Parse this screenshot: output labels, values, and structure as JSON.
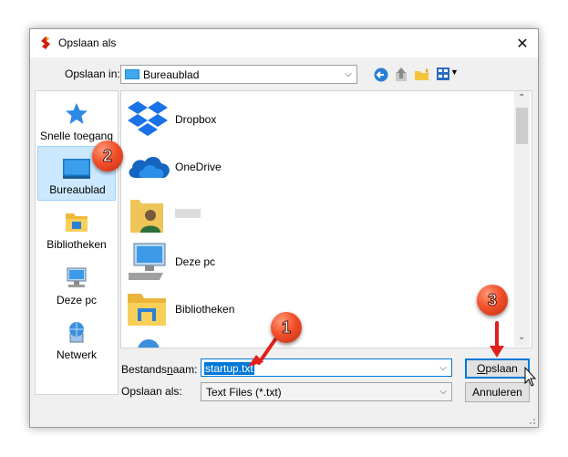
{
  "window": {
    "title": "Opslaan als"
  },
  "toolbar": {
    "save_in_label": "Opslaan in:",
    "location": "Bureaublad"
  },
  "sidebar": {
    "items": [
      {
        "label": "Snelle toegang",
        "icon": "star-icon"
      },
      {
        "label": "Bureaublad",
        "icon": "desktop-icon",
        "selected": true
      },
      {
        "label": "Bibliotheken",
        "icon": "library-folder-icon"
      },
      {
        "label": "Deze pc",
        "icon": "computer-icon"
      },
      {
        "label": "Netwerk",
        "icon": "network-icon"
      }
    ]
  },
  "files": [
    {
      "name": "Dropbox",
      "icon": "dropbox-icon"
    },
    {
      "name": "OneDrive",
      "icon": "onedrive-icon"
    },
    {
      "name": "",
      "icon": "user-folder-icon"
    },
    {
      "name": "Deze pc",
      "icon": "computer-icon"
    },
    {
      "name": "Bibliotheken",
      "icon": "library-folder-icon"
    }
  ],
  "form": {
    "filename_label_pre": "Bestands",
    "filename_label_u": "n",
    "filename_label_post": "aam:",
    "filename_value": "startup.txt",
    "filetype_label": "Opslaan als:",
    "filetype_value": "Text Files (*.txt)"
  },
  "buttons": {
    "save_u": "O",
    "save_rest": "pslaan",
    "cancel": "Annuleren"
  },
  "annotations": {
    "badge1": "1",
    "badge2": "2",
    "badge3": "3"
  },
  "colors": {
    "accent": "#0078d7",
    "badge": "#f2502a",
    "arrow": "#e0201a"
  }
}
